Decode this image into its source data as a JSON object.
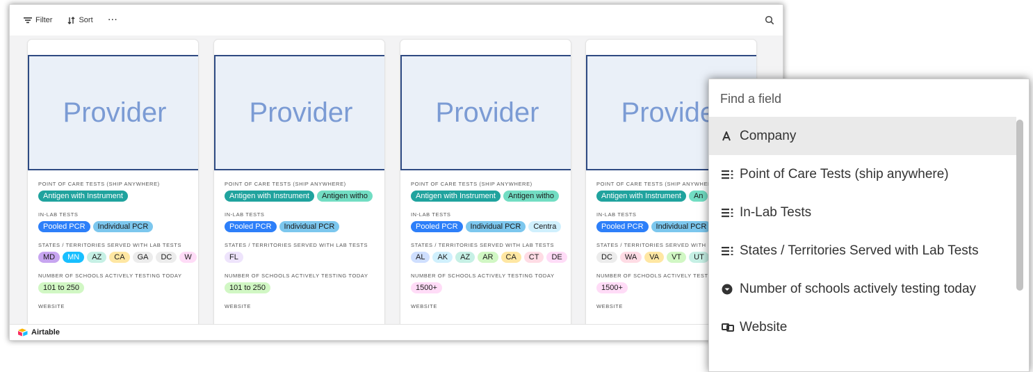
{
  "toolbar": {
    "filter": "Filter",
    "sort": "Sort",
    "more": "···"
  },
  "footer": {
    "brand": "Airtable"
  },
  "cards": [
    {
      "image_text": "Provider",
      "fields": [
        {
          "label": "Point of Care Tests (ship anywhere)",
          "pills": [
            {
              "text": "Antigen with Instrument",
              "bg": "#20a39e",
              "fg": "#ffffff"
            }
          ]
        },
        {
          "label": "In-Lab Tests",
          "pills": [
            {
              "text": "Pooled PCR",
              "bg": "#2d7ff9",
              "fg": "#ffffff"
            },
            {
              "text": "Individual PCR",
              "bg": "#7cc7ee",
              "fg": "#1a1a1a"
            }
          ]
        },
        {
          "label": "States / Territories Served with Lab Tests",
          "pills": [
            {
              "text": "MD",
              "bg": "#c7a5f0",
              "fg": "#1a1a1a"
            },
            {
              "text": "MN",
              "bg": "#18bfff",
              "fg": "#ffffff"
            },
            {
              "text": "AZ",
              "bg": "#c6f0e5",
              "fg": "#1a1a1a"
            },
            {
              "text": "CA",
              "bg": "#ffe7a3",
              "fg": "#1a1a1a"
            },
            {
              "text": "GA",
              "bg": "#ececec",
              "fg": "#1a1a1a"
            },
            {
              "text": "DC",
              "bg": "#ececec",
              "fg": "#1a1a1a"
            },
            {
              "text": "W",
              "bg": "#ffdcf7",
              "fg": "#1a1a1a"
            }
          ]
        },
        {
          "label": "Number of schools actively testing today",
          "pills": [
            {
              "text": "101 to 250",
              "bg": "#d1f7c4",
              "fg": "#1a1a1a"
            }
          ]
        },
        {
          "label": "Website",
          "pills": []
        }
      ]
    },
    {
      "image_text": "Provider",
      "fields": [
        {
          "label": "Point of Care Tests (ship anywhere)",
          "pills": [
            {
              "text": "Antigen with Instrument",
              "bg": "#20a39e",
              "fg": "#ffffff"
            },
            {
              "text": "Antigen witho",
              "bg": "#72ddc3",
              "fg": "#1a1a1a"
            }
          ]
        },
        {
          "label": "In-Lab Tests",
          "pills": [
            {
              "text": "Pooled PCR",
              "bg": "#2d7ff9",
              "fg": "#ffffff"
            },
            {
              "text": "Individual PCR",
              "bg": "#7cc7ee",
              "fg": "#1a1a1a"
            }
          ]
        },
        {
          "label": "States / Territories Served with Lab Tests",
          "pills": [
            {
              "text": "FL",
              "bg": "#eee4fc",
              "fg": "#1a1a1a"
            }
          ]
        },
        {
          "label": "Number of schools actively testing today",
          "pills": [
            {
              "text": "101 to 250",
              "bg": "#d1f7c4",
              "fg": "#1a1a1a"
            }
          ]
        },
        {
          "label": "Website",
          "pills": []
        }
      ]
    },
    {
      "image_text": "Provider",
      "fields": [
        {
          "label": "Point of Care Tests (ship anywhere)",
          "pills": [
            {
              "text": "Antigen with Instrument",
              "bg": "#20a39e",
              "fg": "#ffffff"
            },
            {
              "text": "Antigen witho",
              "bg": "#72ddc3",
              "fg": "#1a1a1a"
            }
          ]
        },
        {
          "label": "In-Lab Tests",
          "pills": [
            {
              "text": "Pooled PCR",
              "bg": "#2d7ff9",
              "fg": "#ffffff"
            },
            {
              "text": "Individual PCR",
              "bg": "#7cc7ee",
              "fg": "#1a1a1a"
            },
            {
              "text": "Centra",
              "bg": "#d0f0fd",
              "fg": "#1a1a1a"
            }
          ]
        },
        {
          "label": "States / Territories Served with Lab Tests",
          "pills": [
            {
              "text": "AL",
              "bg": "#cfdfff",
              "fg": "#1a1a1a"
            },
            {
              "text": "AK",
              "bg": "#d0f0fd",
              "fg": "#1a1a1a"
            },
            {
              "text": "AZ",
              "bg": "#c6f0e5",
              "fg": "#1a1a1a"
            },
            {
              "text": "AR",
              "bg": "#d1f7c4",
              "fg": "#1a1a1a"
            },
            {
              "text": "CA",
              "bg": "#ffe7a3",
              "fg": "#1a1a1a"
            },
            {
              "text": "CT",
              "bg": "#ffdce5",
              "fg": "#1a1a1a"
            },
            {
              "text": "DE",
              "bg": "#ffdcf7",
              "fg": "#1a1a1a"
            }
          ]
        },
        {
          "label": "Number of schools actively testing today",
          "pills": [
            {
              "text": "1500+",
              "bg": "#ffdcf7",
              "fg": "#1a1a1a"
            }
          ]
        },
        {
          "label": "Website",
          "pills": []
        }
      ]
    },
    {
      "image_text": "Provider",
      "fields": [
        {
          "label": "Point of Care Tests (ship anywhere)",
          "pills": [
            {
              "text": "Antigen with Instrument",
              "bg": "#20a39e",
              "fg": "#ffffff"
            },
            {
              "text": "An",
              "bg": "#72ddc3",
              "fg": "#1a1a1a"
            }
          ]
        },
        {
          "label": "In-Lab Tests",
          "pills": [
            {
              "text": "Pooled PCR",
              "bg": "#2d7ff9",
              "fg": "#ffffff"
            },
            {
              "text": "Individual PCR",
              "bg": "#7cc7ee",
              "fg": "#1a1a1a"
            }
          ]
        },
        {
          "label": "States / Territories Served with Lab Tests",
          "pills": [
            {
              "text": "DC",
              "bg": "#ececec",
              "fg": "#1a1a1a"
            },
            {
              "text": "WA",
              "bg": "#ffdce5",
              "fg": "#1a1a1a"
            },
            {
              "text": "VA",
              "bg": "#ffe7a3",
              "fg": "#1a1a1a"
            },
            {
              "text": "VT",
              "bg": "#d1f7c4",
              "fg": "#1a1a1a"
            },
            {
              "text": "UT",
              "bg": "#c6f0e5",
              "fg": "#1a1a1a"
            }
          ]
        },
        {
          "label": "Number of schools actively testing today",
          "pills": [
            {
              "text": "1500+",
              "bg": "#ffdcf7",
              "fg": "#1a1a1a"
            }
          ]
        },
        {
          "label": "Website",
          "pills": []
        }
      ]
    }
  ],
  "field_picker": {
    "placeholder": "Find a field",
    "items": [
      {
        "icon": "text-type-icon",
        "label": "Company",
        "active": true
      },
      {
        "icon": "multi-select-icon",
        "label": "Point of Care Tests (ship anywhere)",
        "active": false
      },
      {
        "icon": "multi-select-icon",
        "label": "In-Lab Tests",
        "active": false
      },
      {
        "icon": "multi-select-icon",
        "label": "States / Territories Served with Lab Tests",
        "active": false
      },
      {
        "icon": "single-select-icon",
        "label": "Number of schools actively testing today",
        "active": false
      },
      {
        "icon": "url-link-icon",
        "label": "Website",
        "active": false
      }
    ]
  }
}
